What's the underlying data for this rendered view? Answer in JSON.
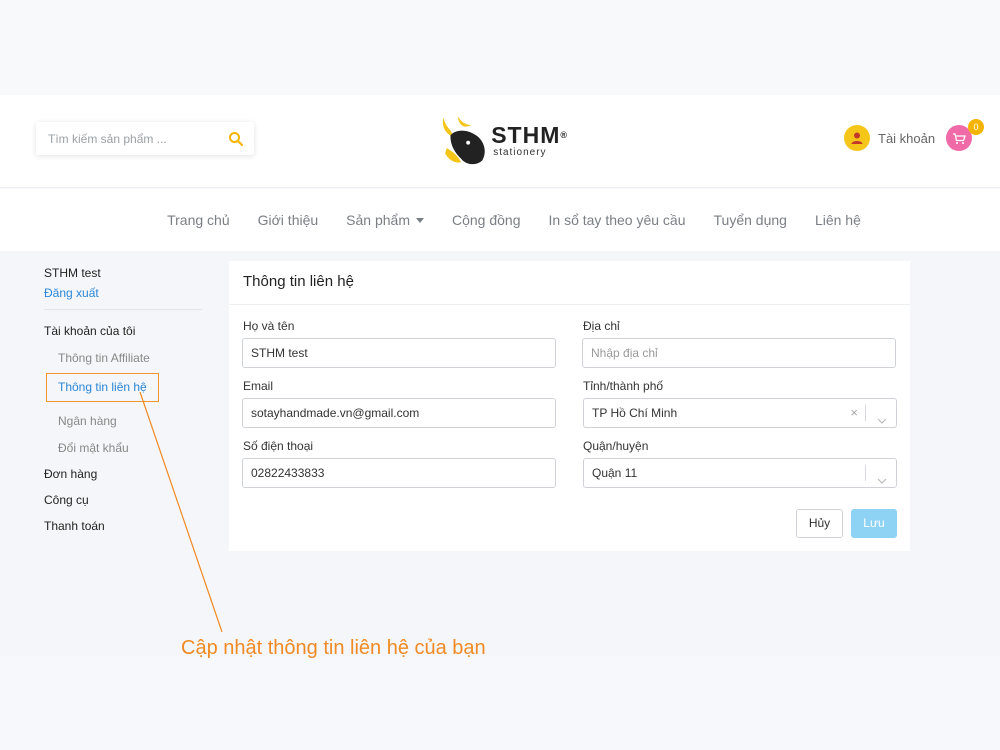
{
  "header": {
    "search_placeholder": "Tìm kiếm sản phẩm ...",
    "logo_brand": "STHM",
    "logo_sub": "stationery",
    "account_label": "Tài khoản",
    "cart_count": "0"
  },
  "nav": {
    "items": [
      "Trang chủ",
      "Giới thiệu",
      "Sản phẩm",
      "Cộng đồng",
      "In sổ tay theo yêu cầu",
      "Tuyển dụng",
      "Liên hệ"
    ]
  },
  "sidebar": {
    "user_name": "STHM test",
    "logout": "Đăng xuất",
    "account_section": "Tài khoản của tôi",
    "sub_items": [
      "Thông tin Affiliate",
      "Thông tin liên hệ",
      "Ngân hàng",
      "Đổi mật khẩu"
    ],
    "main_items": [
      "Đơn hàng",
      "Công cụ",
      "Thanh toán"
    ]
  },
  "form": {
    "title": "Thông tin liên hệ",
    "name_label": "Họ và tên",
    "name_value": "STHM test",
    "address_label": "Địa chỉ",
    "address_placeholder": "Nhập địa chỉ",
    "email_label": "Email",
    "email_value": "sotayhandmade.vn@gmail.com",
    "city_label": "Tỉnh/thành phố",
    "city_value": "TP Hồ Chí Minh",
    "phone_label": "Số điện thoại",
    "phone_value": "02822433833",
    "district_label": "Quận/huyện",
    "district_value": "Quận 11",
    "clear_symbol": "×",
    "cancel_label": "Hủy",
    "save_label": "Lưu"
  },
  "callout": {
    "text": "Cập nhật thông tin liên hệ của bạn"
  },
  "colors": {
    "accent_blue": "#2a86d8",
    "callout_orange": "#f08a24",
    "save_button": "#8ed2f4",
    "logo_yellow": "#f5c518"
  }
}
